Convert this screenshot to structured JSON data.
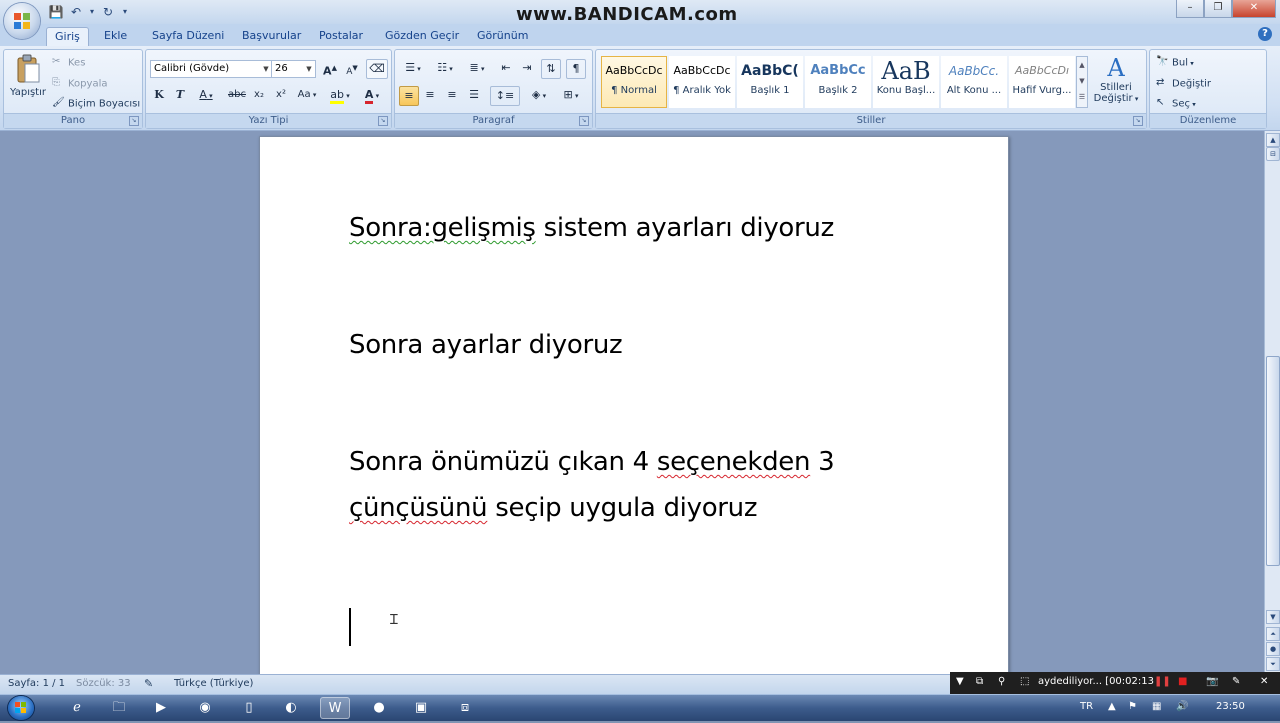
{
  "title_bar": {
    "watermark": "www.BANDICAM.com",
    "window_controls": {
      "minimize": "–",
      "restore": "❐",
      "close": "✕"
    }
  },
  "tabs": [
    {
      "label": "Giriş",
      "active": true
    },
    {
      "label": "Ekle"
    },
    {
      "label": "Sayfa Düzeni"
    },
    {
      "label": "Başvurular"
    },
    {
      "label": "Postalar"
    },
    {
      "label": "Gözden Geçir"
    },
    {
      "label": "Görünüm"
    }
  ],
  "ribbon": {
    "pano": {
      "label": "Pano",
      "paste": "Yapıştır",
      "cut": "Kes",
      "copy": "Kopyala",
      "format_painter": "Biçim Boyacısı"
    },
    "font": {
      "label": "Yazı Tipi",
      "font_name": "Calibri (Gövde)",
      "font_size": "26",
      "bold": "K",
      "italic": "T",
      "underline": "A",
      "strike": "abc",
      "subscript": "x₂",
      "superscript": "x²",
      "change_case": "Aa",
      "grow": "A",
      "shrink": "A",
      "font_color": "A"
    },
    "paragraph": {
      "label": "Paragraf",
      "pilcrow": "¶"
    },
    "styles": {
      "label": "Stiller",
      "items": [
        {
          "preview": "AaBbCcDc",
          "name": "¶ Normal",
          "selected": true
        },
        {
          "preview": "AaBbCcDc",
          "name": "¶ Aralık Yok"
        },
        {
          "preview": "AaBbC(",
          "name": "Başlık 1"
        },
        {
          "preview": "AaBbCc",
          "name": "Başlık 2"
        },
        {
          "preview": "AaB",
          "name": "Konu Başl..."
        },
        {
          "preview": "AaBbCc.",
          "name": "Alt Konu ..."
        },
        {
          "preview": "AaBbCcDı",
          "name": "Hafif Vurg..."
        }
      ],
      "change_styles_line1": "Stilleri",
      "change_styles_line2": "Değiştir"
    },
    "editing": {
      "label": "Düzenleme",
      "find": "Bul",
      "replace": "Değiştir",
      "select": "Seç"
    }
  },
  "document": {
    "lines": [
      {
        "parts": [
          {
            "text": "Sonra:gelişmiş",
            "squiggle": "green"
          },
          {
            "text": " sistem ayarları diyoruz"
          }
        ]
      },
      {
        "parts": [
          {
            "text": "Sonra ayarlar diyoruz"
          }
        ]
      },
      {
        "parts": [
          {
            "text": "Sonra önümüzü çıkan 4 "
          },
          {
            "text": "seçenekden",
            "squiggle": "red"
          },
          {
            "text": " 3"
          }
        ]
      },
      {
        "parts": [
          {
            "text": "çünçüsünü",
            "squiggle": "red"
          },
          {
            "text": " seçip uygula diyoruz"
          }
        ]
      }
    ]
  },
  "status_bar": {
    "page": "Sayfa: 1 / 1",
    "words": "Sözcük: 33",
    "language": "Türkçe (Türkiye)"
  },
  "bandicam": {
    "status": "aydediliyor... [00:02:13"
  },
  "taskbar": {
    "lang": "TR",
    "clock": "23:50"
  },
  "colors": {
    "ribbon_bg": "#d1e0f3",
    "doc_bg": "#8599bb",
    "green_squiggle": "#2e9a2e",
    "red_squiggle": "#d6252e"
  }
}
